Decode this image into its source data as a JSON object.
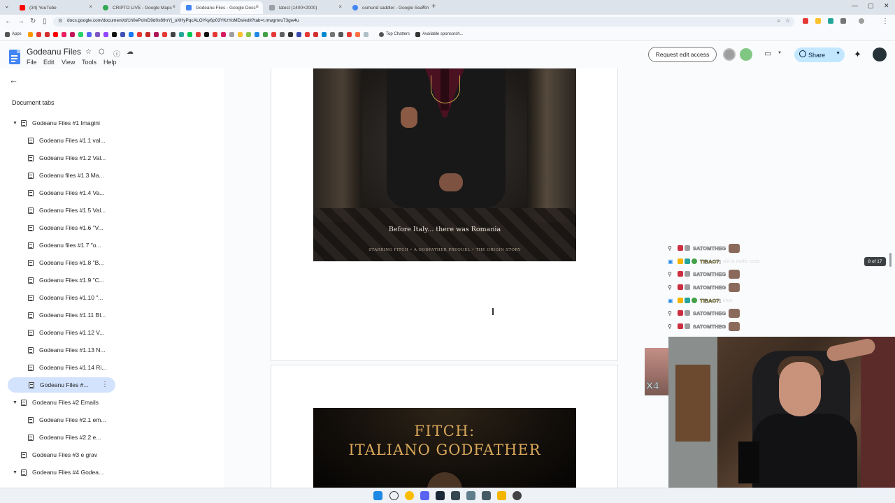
{
  "browser": {
    "tabs": [
      {
        "label": "(34) YouTube",
        "color": "#ff0000"
      },
      {
        "label": "CRIPTO LIVE - Google Maps",
        "color": "#34a853"
      },
      {
        "label": "Godeanu Files - Google Docs",
        "color": "#4285f4"
      },
      {
        "label": "latest (1400×2000)",
        "color": "#9aa0a6"
      },
      {
        "label": "osmund saddler - Google Search",
        "color": "#4285f4"
      }
    ],
    "url": "docs.google.com/document/d/1h0ePoInD9d0x89nYj_oXHyPqcALOYky6p03YKzYoMDs/edit?tab=t.mwgmru73gw4u",
    "bookmarks": {
      "apps_label": "Apps",
      "top_chatters": "Top Chatters",
      "available": "Available sponsorsh..."
    }
  },
  "docs": {
    "title": "Godeanu Files",
    "menu": [
      "File",
      "Edit",
      "View",
      "Tools",
      "Help"
    ],
    "request_edit": "Request edit access",
    "share": "Share"
  },
  "sidebar": {
    "heading": "Document tabs",
    "items": [
      {
        "label": "Godeanu Files #1 Imagini"
      },
      {
        "label": "Godeanu Files #1.1 val..."
      },
      {
        "label": "Godeanu Files #1.2 Val..."
      },
      {
        "label": "Godeanu files #1.3 Ma..."
      },
      {
        "label": "Godeanu Files #1.4 Va..."
      },
      {
        "label": "Godeanu Files #1.5 Val..."
      },
      {
        "label": "Godeanu Files #1.6 \"V..."
      },
      {
        "label": "Godeanu files #1.7 \"o..."
      },
      {
        "label": "Godeanu Files #1.8 \"B..."
      },
      {
        "label": "Godeanu Files #1.9 \"C..."
      },
      {
        "label": "Godeanu Files #1.10 \"..."
      },
      {
        "label": "Godeanu Files #1.11 Bl..."
      },
      {
        "label": "Godeanu Files #1.12 V..."
      },
      {
        "label": "Godeanu Files #1.13 N..."
      },
      {
        "label": "Godeanu Files #1.14 Ri..."
      },
      {
        "label": "Godeanu Files #..."
      },
      {
        "label": "Godeanu Files #2 Emails"
      },
      {
        "label": "Godeanu Files #2.1 em..."
      },
      {
        "label": "Godeanu Files #2.2 e..."
      },
      {
        "label": "Godeanu Files #3 e grav"
      },
      {
        "label": "Godeanu Files #4 Godea..."
      }
    ]
  },
  "document": {
    "poster1": {
      "caption": "Before Italy... there was Romania",
      "credits": "STARRING FITCH • A GODFATHER PREQUEL • THE ORIGIN STORY"
    },
    "poster2": {
      "title_line1": "FITCH:",
      "title_line2": "ITALIANO GODFATHER"
    },
    "page_indicator": "8 of 17"
  },
  "stream_overlay": {
    "chat": [
      {
        "user": "SATOMTHEG",
        "badge": "#cc2d3f",
        "msg": ""
      },
      {
        "user": "TIBAO7:",
        "badge": "#1e88e5",
        "msg": "ala la mafie cosa"
      },
      {
        "user": "SATOMTHEG",
        "badge": "#cc2d3f",
        "msg": ""
      },
      {
        "user": "SATOMTHEG",
        "badge": "#cc2d3f",
        "msg": ""
      },
      {
        "user": "TIBAO7:",
        "badge": "#1e88e5",
        "msg": "kreu"
      },
      {
        "user": "SATOMTHEG",
        "badge": "#cc2d3f",
        "msg": ""
      },
      {
        "user": "SATOMTHEG",
        "badge": "#cc2d3f",
        "msg": ""
      }
    ],
    "side_text": "X4"
  }
}
